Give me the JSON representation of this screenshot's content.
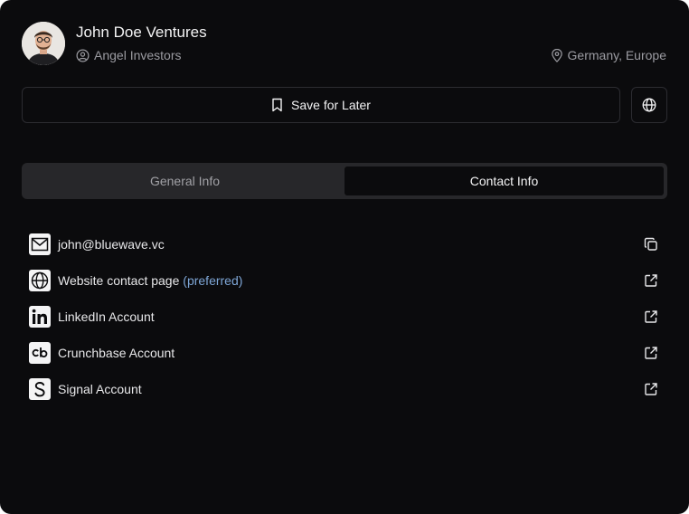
{
  "profile": {
    "name": "John Doe Ventures",
    "type": "Angel Investors",
    "location": "Germany, Europe"
  },
  "actions": {
    "save_label": "Save for Later"
  },
  "tabs": [
    {
      "label": "General Info",
      "active": false
    },
    {
      "label": "Contact Info",
      "active": true
    }
  ],
  "contacts": [
    {
      "icon": "mail-icon",
      "label": "john@bluewave.vc",
      "note": "",
      "action": "copy-icon"
    },
    {
      "icon": "globe-icon",
      "label": "Website contact page",
      "note": "(preferred)",
      "action": "external-link-icon"
    },
    {
      "icon": "linkedin-icon",
      "label": "LinkedIn Account",
      "note": "",
      "action": "external-link-icon"
    },
    {
      "icon": "crunchbase-icon",
      "label": "Crunchbase Account",
      "note": "",
      "action": "external-link-icon"
    },
    {
      "icon": "signal-icon",
      "label": "Signal Account",
      "note": "",
      "action": "external-link-icon"
    }
  ],
  "colors": {
    "background": "#0b0b0d",
    "border": "#2c2c31",
    "tab_track": "#27272a",
    "muted_text": "#9b9ba1",
    "accent_preferred": "#7ea6d6"
  }
}
